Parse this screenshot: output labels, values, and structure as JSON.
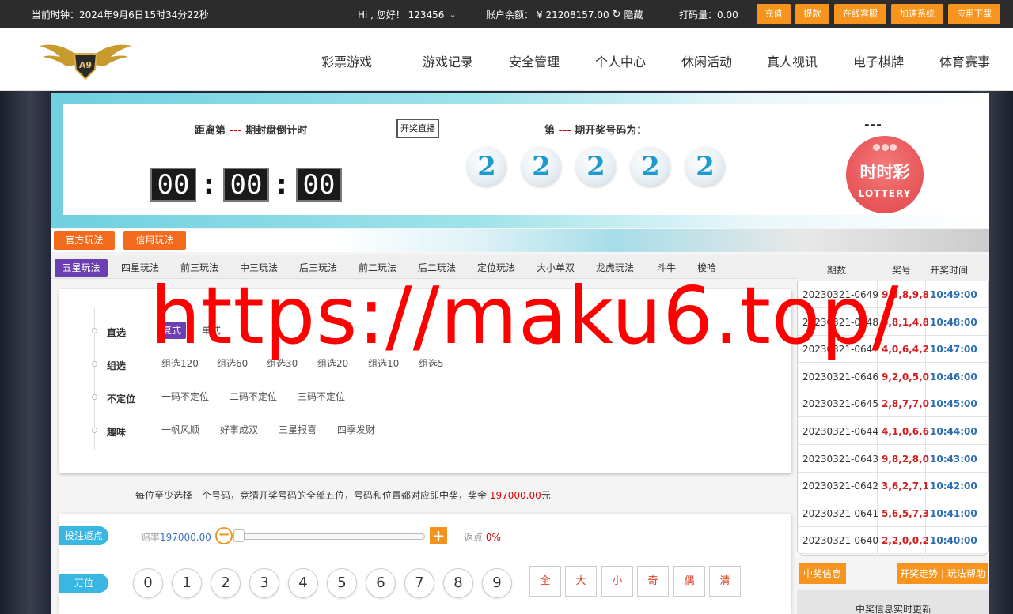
{
  "topbar": {
    "clock": "当前时钟：2024年9月6日15时34分22秒",
    "greeting": "Hi , 您好！ 123456",
    "balance_label": "账户余额：",
    "balance": "¥ 21208157.00",
    "hide": "隐藏",
    "code_amount": "打码量：0.00",
    "buttons": [
      "充值",
      "提款",
      "在线客服",
      "加速系统",
      "应用下载"
    ]
  },
  "nav": [
    "彩票游戏",
    "游戏记录",
    "安全管理",
    "个人中心",
    "休闲活动",
    "真人视讯",
    "电子棋牌",
    "体育赛事"
  ],
  "banner": {
    "countdown_prefix": "距离第",
    "countdown_issue": "---",
    "countdown_suffix": "期封盘倒计时",
    "live_button": "开奖直播",
    "hours": "00",
    "minutes": "00",
    "seconds": "00",
    "draw_prefix": "第",
    "draw_issue": "---",
    "draw_suffix": "期开奖号码为：",
    "balls": [
      "2",
      "2",
      "2",
      "2",
      "2"
    ],
    "top_dashes": "---",
    "logo_cn": "时时彩",
    "logo_en": "LOTTERY"
  },
  "play_modes": [
    "官方玩法",
    "信用玩法"
  ],
  "tabs": [
    "五星玩法",
    "四星玩法",
    "前三玩法",
    "中三玩法",
    "后三玩法",
    "前二玩法",
    "后二玩法",
    "定位玩法",
    "大小单双",
    "龙虎玩法",
    "斗牛",
    "梭哈"
  ],
  "subplay": {
    "rows": [
      {
        "label": "直选",
        "options": [
          "复式",
          "单式"
        ]
      },
      {
        "label": "组选",
        "options": [
          "组选120",
          "组选60",
          "组选30",
          "组选20",
          "组选10",
          "组选5"
        ]
      },
      {
        "label": "不定位",
        "options": [
          "一码不定位",
          "二码不定位",
          "三码不定位"
        ]
      },
      {
        "label": "趣味",
        "options": [
          "一帆风顺",
          "好事成双",
          "三星报喜",
          "四季发财"
        ]
      }
    ]
  },
  "description": {
    "text": "每位至少选择一个号码，竞猜开奖号码的全部五位，号码和位置都对应即中奖，奖金",
    "prize": "197000.00",
    "unit": "元"
  },
  "bet": {
    "rebate_pill": "投注返点",
    "odds_label": "赔率",
    "odds_value": "197000.00",
    "slider_level": 0,
    "rebate_label": "返点",
    "rebate_value": "0%",
    "position_label": "万位",
    "numbers": [
      "0",
      "1",
      "2",
      "3",
      "4",
      "5",
      "6",
      "7",
      "8",
      "9"
    ],
    "quick": [
      "全",
      "大",
      "小",
      "奇",
      "偶",
      "清"
    ]
  },
  "history": {
    "headers": [
      "期数",
      "奖号",
      "开奖时间"
    ],
    "rows": [
      {
        "period": "20230321-0649",
        "numbers": "9,3,8,9,8",
        "time": "10:49:00"
      },
      {
        "period": "20230321-0648",
        "numbers": "0,8,1,4,8",
        "time": "10:48:00"
      },
      {
        "period": "20230321-0647",
        "numbers": "4,0,6,4,2",
        "time": "10:47:00"
      },
      {
        "period": "20230321-0646",
        "numbers": "9,2,0,5,0",
        "time": "10:46:00"
      },
      {
        "period": "20230321-0645",
        "numbers": "2,8,7,7,0",
        "time": "10:45:00"
      },
      {
        "period": "20230321-0644",
        "numbers": "4,1,0,6,6",
        "time": "10:44:00"
      },
      {
        "period": "20230321-0643",
        "numbers": "9,8,2,8,0",
        "time": "10:43:00"
      },
      {
        "period": "20230321-0642",
        "numbers": "3,6,2,7,1",
        "time": "10:42:00"
      },
      {
        "period": "20230321-0641",
        "numbers": "5,6,5,7,3",
        "time": "10:41:00"
      },
      {
        "period": "20230321-0640",
        "numbers": "2,2,0,0,2",
        "time": "10:40:00"
      }
    ],
    "win_info": "中奖信息",
    "trend_help": "开奖走势 | 玩法帮助",
    "realtime": "中奖信息实时更新"
  },
  "watermark": "https://maku6.top/",
  "colors": {
    "accent": "#f7941d",
    "purple": "#6b3fb2",
    "red": "#d02020",
    "blue": "#2a6db3",
    "cyan": "#3ab6e3"
  }
}
